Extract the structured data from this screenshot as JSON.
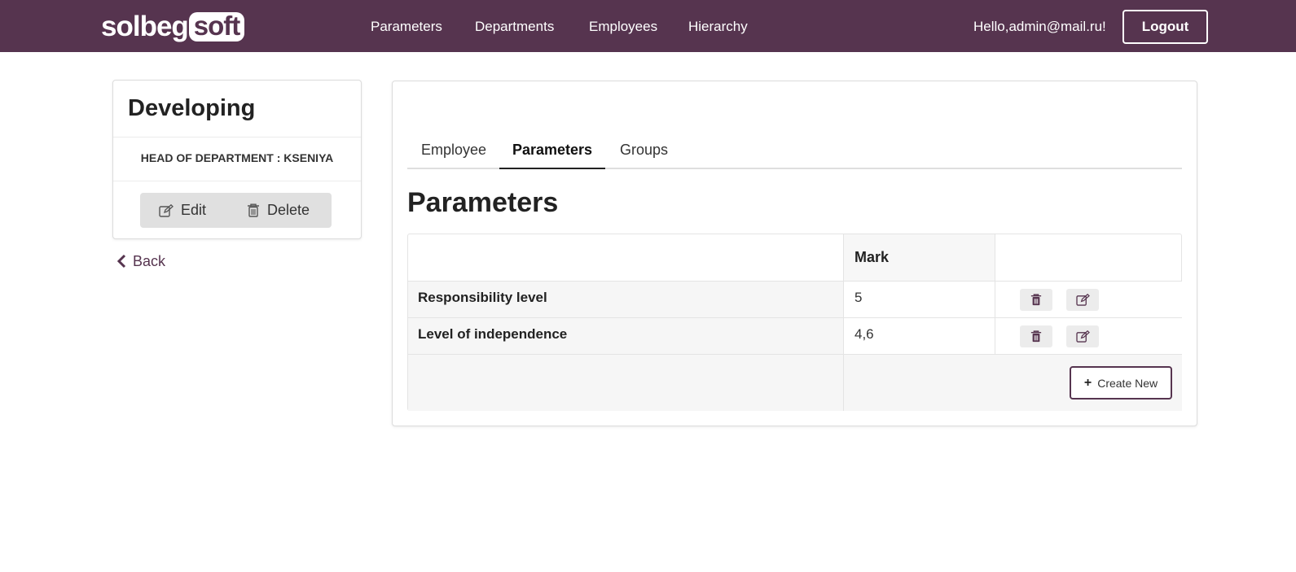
{
  "brand": {
    "part1": "solbeg",
    "part2": "soft"
  },
  "nav": {
    "items": [
      {
        "label": "Parameters"
      },
      {
        "label": "Departments"
      },
      {
        "label": "Employees"
      },
      {
        "label": "Hierarchy"
      }
    ],
    "greeting": "Hello,admin@mail.ru!",
    "logout_label": "Logout"
  },
  "department": {
    "title": "Developing",
    "head_line": "HEAD OF DEPARTMENT : KSENIYA",
    "edit_label": "Edit",
    "delete_label": "Delete"
  },
  "back_label": "Back",
  "tabs": [
    {
      "label": "Employee",
      "active": false
    },
    {
      "label": "Parameters",
      "active": true
    },
    {
      "label": "Groups",
      "active": false
    }
  ],
  "parameters": {
    "title": "Parameters",
    "columns": {
      "mark": "Mark"
    },
    "rows": [
      {
        "name": "Responsibility level",
        "mark": "5"
      },
      {
        "name": "Level of independence",
        "mark": "4,6"
      }
    ],
    "create_label": "Create New"
  },
  "icons": {
    "edit": "edit-icon",
    "delete": "trash-icon",
    "back": "chevron-left-icon",
    "plus": "plus-icon"
  },
  "colors": {
    "brand": "#56344f",
    "nav_text": "#ffffff",
    "table_row_bg": "#f6f6f6"
  }
}
